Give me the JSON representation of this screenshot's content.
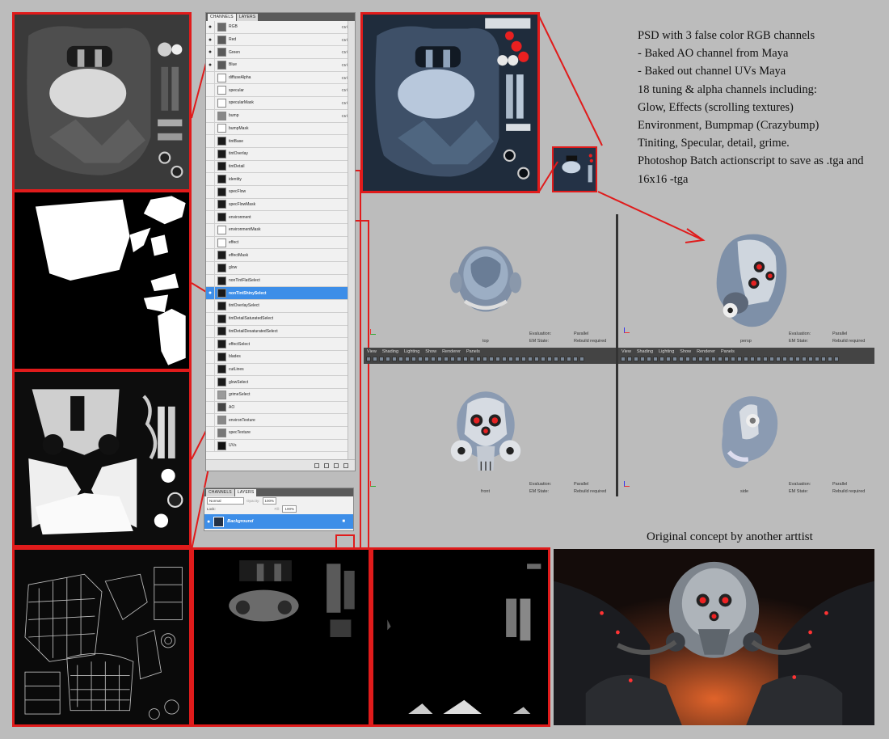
{
  "notes": {
    "lines": [
      "PSD with 3 false color RGB channels",
      "- Baked AO channel from Maya",
      "- Baked out channel UVs Maya",
      "18 tuning & alpha channels including:",
      "Glow, Effects (scrolling textures)",
      "Environment, Bumpmap (Crazybump)",
      "Tiniting, Specular, detail, grime.",
      "Photoshop Batch actionscript to save as .tga and 16x16 -tga"
    ]
  },
  "concept_title": "Original concept by another arttist",
  "channels_panel": {
    "tabs": [
      "CHANNELS",
      "LAYERS"
    ],
    "channels": [
      {
        "name": "RGB",
        "shortcut": "Ctrl+2"
      },
      {
        "name": "Red",
        "shortcut": "Ctrl+3"
      },
      {
        "name": "Green",
        "shortcut": "Ctrl+4"
      },
      {
        "name": "Blue",
        "shortcut": "Ctrl+5"
      },
      {
        "name": "diffuseAlpha",
        "shortcut": "Ctrl+6"
      },
      {
        "name": "specular",
        "shortcut": "Ctrl+7"
      },
      {
        "name": "specularMask",
        "shortcut": "Ctrl+8"
      },
      {
        "name": "bump",
        "shortcut": "Ctrl+9"
      },
      {
        "name": "bumpMask",
        "shortcut": ""
      },
      {
        "name": "tintBase",
        "shortcut": ""
      },
      {
        "name": "tintOverlay",
        "shortcut": ""
      },
      {
        "name": "tintDetail",
        "shortcut": ""
      },
      {
        "name": "identity",
        "shortcut": ""
      },
      {
        "name": "specFlow",
        "shortcut": ""
      },
      {
        "name": "specFlowMask",
        "shortcut": ""
      },
      {
        "name": "environment",
        "shortcut": ""
      },
      {
        "name": "environmentMask",
        "shortcut": ""
      },
      {
        "name": "effect",
        "shortcut": ""
      },
      {
        "name": "effectMask",
        "shortcut": ""
      },
      {
        "name": "glow",
        "shortcut": ""
      },
      {
        "name": "nonTintFlatSelect",
        "shortcut": ""
      },
      {
        "name": "nonTintShinySelect",
        "shortcut": "",
        "selected": true
      },
      {
        "name": "tintOverlaySelect",
        "shortcut": ""
      },
      {
        "name": "tintDetailSaturatedSelect",
        "shortcut": ""
      },
      {
        "name": "tintDetailDesaturatedSelect",
        "shortcut": ""
      },
      {
        "name": "effectSelect",
        "shortcut": ""
      },
      {
        "name": "blades",
        "shortcut": ""
      },
      {
        "name": "cutLines",
        "shortcut": ""
      },
      {
        "name": "glowSelect",
        "shortcut": ""
      },
      {
        "name": "grimeSelect",
        "shortcut": ""
      },
      {
        "name": "AO",
        "shortcut": ""
      },
      {
        "name": "environTexture",
        "shortcut": ""
      },
      {
        "name": "specTexture",
        "shortcut": ""
      },
      {
        "name": "UVs",
        "shortcut": ""
      }
    ]
  },
  "layers_panel": {
    "tabs": [
      "CHANNELS",
      "LAYERS"
    ],
    "blend_mode": "Normal",
    "opacity_label": "Opacity:",
    "opacity": "100%",
    "lock_label": "Lock:",
    "fill_label": "Fill:",
    "fill": "100%",
    "layer_name": "Background"
  },
  "maya": {
    "menu": [
      "View",
      "Shading",
      "Lighting",
      "Show",
      "Renderer",
      "Panels"
    ],
    "views": [
      {
        "name": "top",
        "eval_label": "Evaluation:",
        "eval_value": "Parallel",
        "em_label": "EM State:",
        "em_value": "Rebuild required"
      },
      {
        "name": "persp",
        "eval_label": "Evaluation:",
        "eval_value": "Parallel",
        "em_label": "EM State:",
        "em_value": "Rebuild required"
      },
      {
        "name": "front",
        "eval_label": "Evaluation:",
        "eval_value": "Parallel",
        "em_label": "EM State:",
        "em_value": "Rebuild required"
      },
      {
        "name": "side",
        "eval_label": "Evaluation:",
        "eval_value": "Parallel",
        "em_label": "EM State:",
        "em_value": "Rebuild required"
      }
    ]
  },
  "colors": {
    "background": "#bcbcbc",
    "frame_red": "#e01b1b",
    "selection_blue": "#3d8ee8"
  }
}
